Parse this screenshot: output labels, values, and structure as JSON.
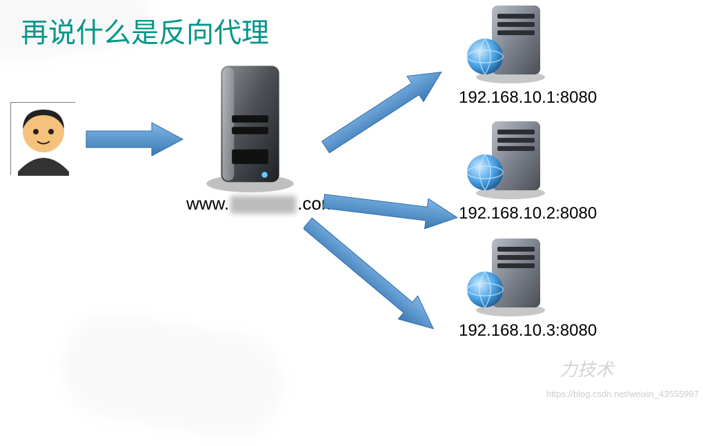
{
  "title": "再说什么是反向代理",
  "proxy_domain_prefix": "www.",
  "proxy_domain_suffix": ".com",
  "servers": [
    {
      "ip": "192.168.10.1:8080"
    },
    {
      "ip": "192.168.10.2:8080"
    },
    {
      "ip": "192.168.10.3:8080"
    }
  ],
  "watermark_left": "力技术",
  "watermark": "https://blog.csdn.net/weixin_43555997",
  "colors": {
    "title": "#009688",
    "arrow": "#4F8FCB"
  }
}
